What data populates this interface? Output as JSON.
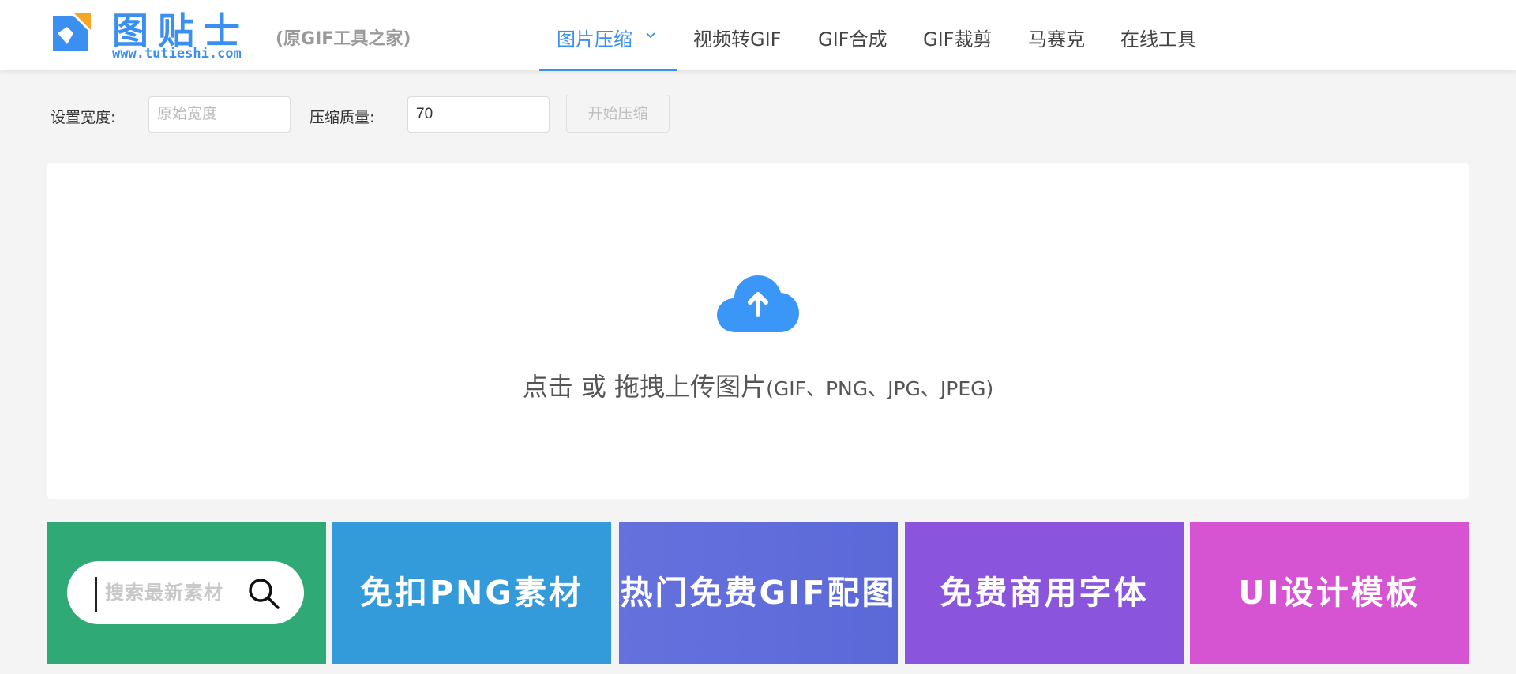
{
  "brand": {
    "title": "图贴士",
    "url": "www.tutieshi.com",
    "subtitle": "(原GIF工具之家)",
    "logo_icon": "tutieshi-logo-icon"
  },
  "nav": {
    "items": [
      {
        "label": "图片压缩",
        "active": true
      },
      {
        "label": "视频转GIF"
      },
      {
        "label": "GIF合成"
      },
      {
        "label": "GIF裁剪"
      },
      {
        "label": "马赛克"
      },
      {
        "label": "在线工具"
      }
    ],
    "dropdown_icon": "chevron-down-icon"
  },
  "settings": {
    "width_label": "设置宽度:",
    "width_placeholder": "原始宽度",
    "width_value": "",
    "quality_label": "压缩质量:",
    "quality_value": "70",
    "start_button": "开始压缩"
  },
  "upload": {
    "icon": "cloud-upload-icon",
    "main_text": "点击 或 拖拽上传图片",
    "formats": "(GIF、PNG、JPG、JPEG)"
  },
  "banners": {
    "search_placeholder": "搜索最新素材",
    "search_icon": "search-icon",
    "items": [
      {
        "label": "免扣PNG素材"
      },
      {
        "label": "热门免费GIF配图"
      },
      {
        "label": "免费商用字体"
      },
      {
        "label": "UI设计模板"
      }
    ]
  },
  "colors": {
    "accent": "#3a8ff1",
    "banner_green": "#2faa76",
    "banner_blue": "#339bd9",
    "banner_indigo": "#6571dd",
    "banner_purple": "#8a55dc",
    "banner_pink": "#d654d2"
  }
}
